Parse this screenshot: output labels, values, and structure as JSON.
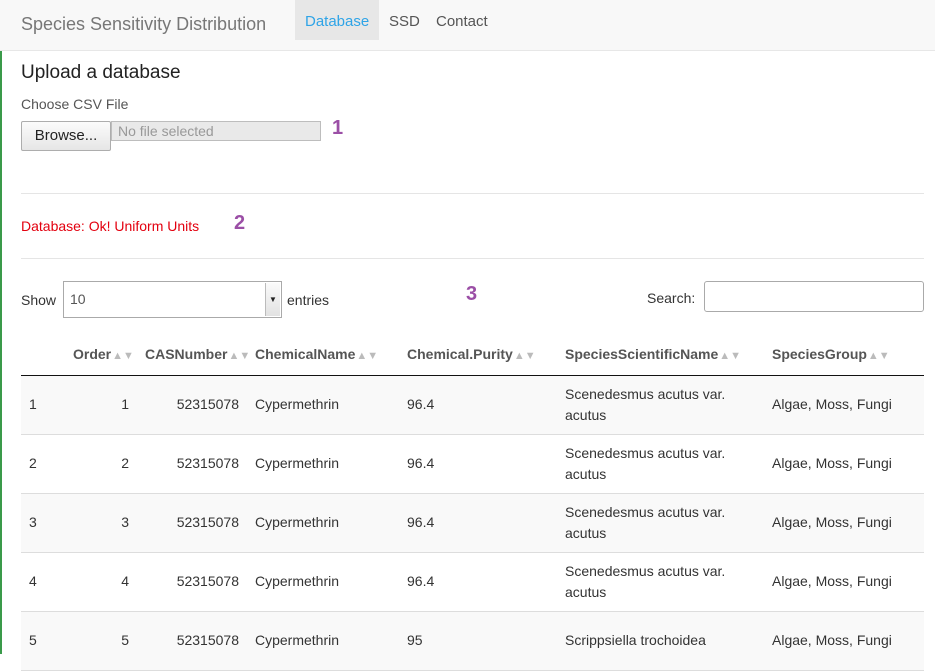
{
  "navbar": {
    "brand": "Species Sensitivity Distribution",
    "tabs": [
      {
        "label": "Database",
        "active": true
      },
      {
        "label": "SSD",
        "active": false
      },
      {
        "label": "Contact",
        "active": false
      }
    ]
  },
  "upload": {
    "title": "Upload a database",
    "file_label": "Choose CSV File",
    "browse_label": "Browse...",
    "file_status": "No file selected"
  },
  "markers": [
    "1",
    "2",
    "3"
  ],
  "status": {
    "text": "Database: Ok! Uniform Units",
    "color": "#e3000f"
  },
  "table_controls": {
    "show_label": "Show",
    "entries_value": "10",
    "entries_label": "entries",
    "search_label": "Search:",
    "search_value": ""
  },
  "table": {
    "columns": [
      "",
      "Order",
      "CASNumber",
      "ChemicalName",
      "Chemical.Purity",
      "SpeciesScientificName",
      "SpeciesGroup"
    ],
    "rows": [
      [
        "1",
        "1",
        "52315078",
        "Cypermethrin",
        "96.4",
        "Scenedesmus acutus var. acutus",
        "Algae, Moss, Fungi"
      ],
      [
        "2",
        "2",
        "52315078",
        "Cypermethrin",
        "96.4",
        "Scenedesmus acutus var. acutus",
        "Algae, Moss, Fungi"
      ],
      [
        "3",
        "3",
        "52315078",
        "Cypermethrin",
        "96.4",
        "Scenedesmus acutus var. acutus",
        "Algae, Moss, Fungi"
      ],
      [
        "4",
        "4",
        "52315078",
        "Cypermethrin",
        "96.4",
        "Scenedesmus acutus var. acutus",
        "Algae, Moss, Fungi"
      ],
      [
        "5",
        "5",
        "52315078",
        "Cypermethrin",
        "95",
        "Scrippsiella trochoidea",
        "Algae, Moss, Fungi"
      ]
    ]
  },
  "colors": {
    "accent": "#2fa4e7",
    "marker": "#9b4fa6"
  }
}
